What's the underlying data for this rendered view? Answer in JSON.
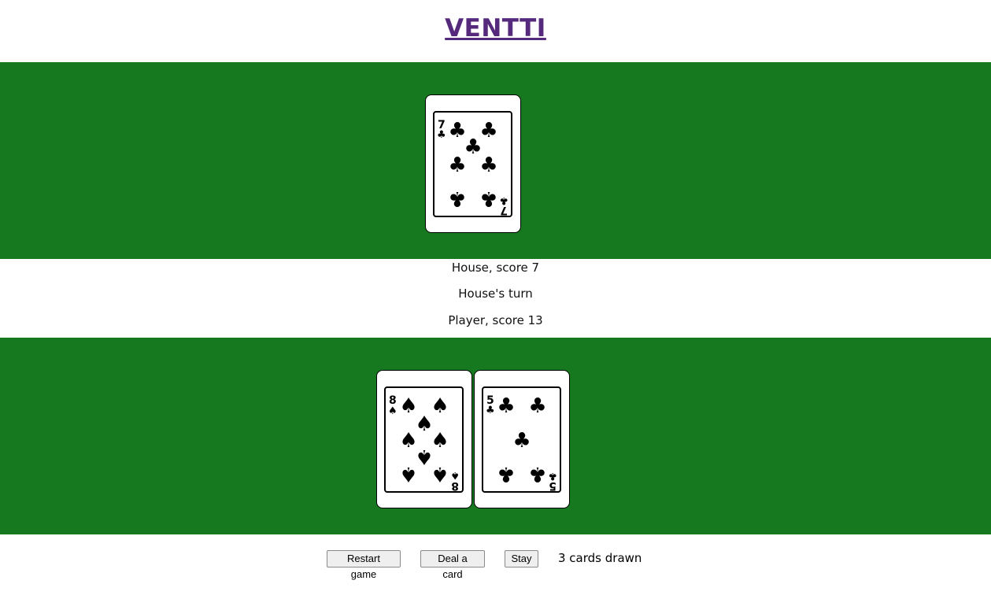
{
  "title": "VENTTI",
  "house": {
    "label": "House, score 7",
    "cards": [
      {
        "rank": "7",
        "suit": "clubs",
        "suit_symbol": "♣"
      }
    ]
  },
  "turn_status": "House's turn",
  "player": {
    "label": "Player, score 13",
    "cards": [
      {
        "rank": "8",
        "suit": "spades",
        "suit_symbol": "♠"
      },
      {
        "rank": "5",
        "suit": "clubs",
        "suit_symbol": "♣"
      }
    ]
  },
  "controls": {
    "restart_label": "Restart game",
    "deal_label": "Deal a card",
    "stay_label": "Stay",
    "cards_drawn": "3 cards drawn"
  },
  "colors": {
    "felt": "#16791f",
    "title": "#55297c"
  }
}
